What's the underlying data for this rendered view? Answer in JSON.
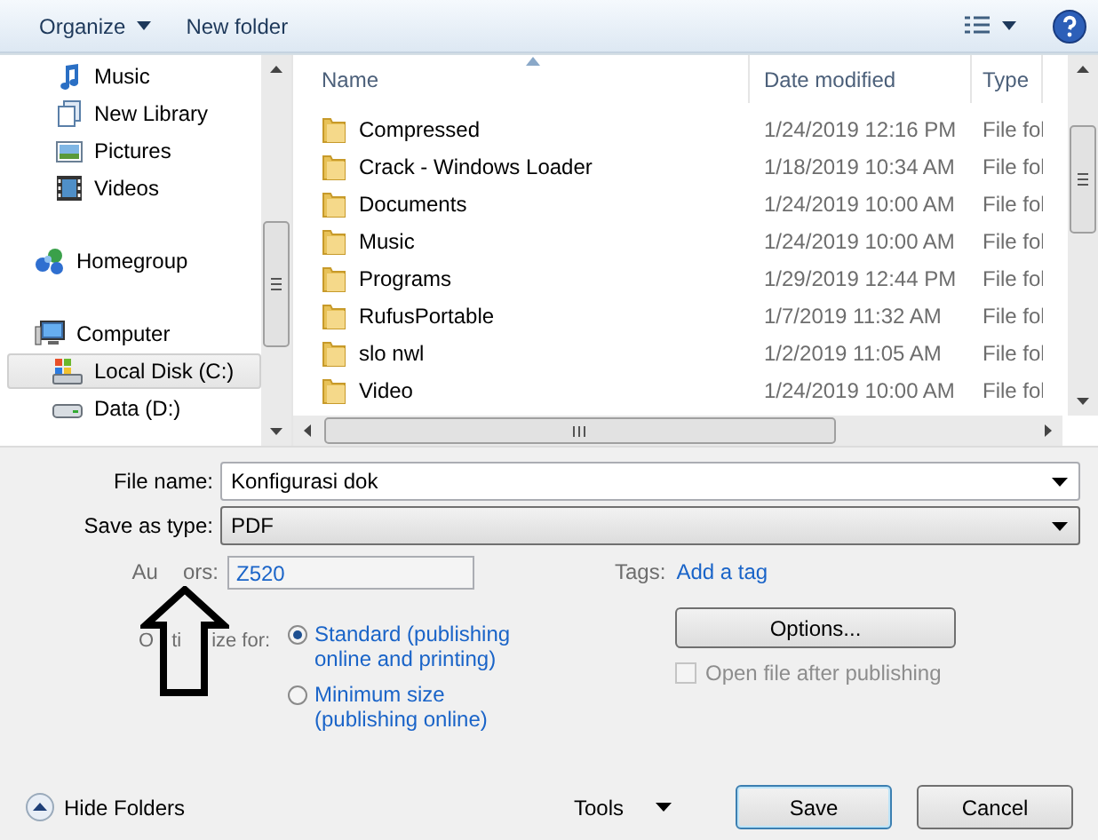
{
  "toolbar": {
    "organize": "Organize",
    "new_folder": "New folder"
  },
  "libraries": [
    {
      "label": "Music",
      "kind": "music",
      "selected": false
    },
    {
      "label": "New Library",
      "kind": "library",
      "selected": false
    },
    {
      "label": "Pictures",
      "kind": "pictures",
      "selected": false
    },
    {
      "label": "Videos",
      "kind": "videos",
      "selected": false
    }
  ],
  "nav": [
    {
      "label": "Homegroup",
      "kind": "homegroup",
      "selected": false
    },
    {
      "label": "Computer",
      "kind": "computer",
      "selected": false,
      "children": [
        {
          "label": "Local Disk (C:)",
          "kind": "disk",
          "selected": true
        },
        {
          "label": "Data (D:)",
          "kind": "drive",
          "selected": false
        }
      ]
    }
  ],
  "columns": [
    "Name",
    "Date modified",
    "Type"
  ],
  "rows": [
    {
      "name": "Compressed",
      "date": "1/24/2019 12:16 PM",
      "type": "File fol"
    },
    {
      "name": "Crack - Windows Loader",
      "date": "1/18/2019 10:34 AM",
      "type": "File fol"
    },
    {
      "name": "Documents",
      "date": "1/24/2019 10:00 AM",
      "type": "File fol"
    },
    {
      "name": "Music",
      "date": "1/24/2019 10:00 AM",
      "type": "File fol"
    },
    {
      "name": "Programs",
      "date": "1/29/2019 12:44 PM",
      "type": "File fol"
    },
    {
      "name": "RufusPortable",
      "date": "1/7/2019 11:32 AM",
      "type": "File fol"
    },
    {
      "name": "slo nwl",
      "date": "1/2/2019 11:05 AM",
      "type": "File fol"
    },
    {
      "name": "Video",
      "date": "1/24/2019 10:00 AM",
      "type": "File fol"
    }
  ],
  "file_name": {
    "label": "File name:",
    "value": "Konfigurasi dok"
  },
  "save_as_type": {
    "label": "Save as type:",
    "value": "PDF"
  },
  "authors": {
    "label_parts": [
      "Au",
      "ors:"
    ],
    "value": "Z520"
  },
  "tags": {
    "label": "Tags:",
    "link": "Add a tag"
  },
  "optimize": {
    "label_parts": [
      "O",
      "ti",
      "ize for:"
    ],
    "options": [
      {
        "label": "Standard (publishing online and printing)",
        "selected": true
      },
      {
        "label": "Minimum size (publishing online)",
        "selected": false
      }
    ]
  },
  "options_button": "Options...",
  "open_after": {
    "label": "Open file after publishing",
    "checked": false,
    "disabled": true
  },
  "hide_folders": "Hide Folders",
  "tools": "Tools",
  "save": "Save",
  "cancel": "Cancel"
}
